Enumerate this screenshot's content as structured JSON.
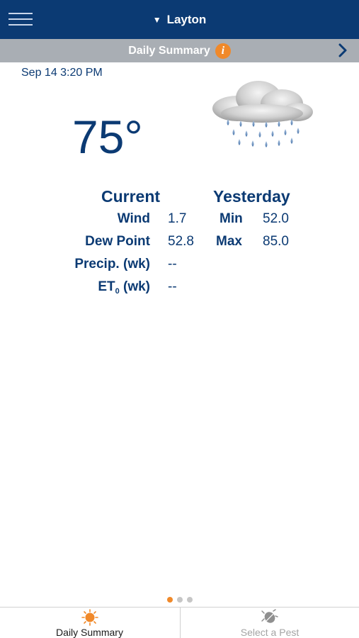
{
  "header": {
    "location": "Layton",
    "subtitle": "Daily Summary"
  },
  "summary": {
    "timestamp": "Sep 14 3:20 PM",
    "temperature": "75°",
    "weather_icon": "rain-cloud-icon"
  },
  "current": {
    "heading": "Current",
    "wind_label": "Wind",
    "wind_value": "1.7",
    "dew_label": "Dew Point",
    "dew_value": "52.8",
    "precip_label": "Precip. (wk)",
    "precip_value": "--",
    "et_label_main": "ET",
    "et_label_sub": "0",
    "et_label_tail": " (wk)",
    "et_value": "--"
  },
  "yesterday": {
    "heading": "Yesterday",
    "min_label": "Min",
    "min_value": "52.0",
    "max_label": "Max",
    "max_value": "85.0"
  },
  "pager": {
    "pages": 3,
    "active": 0
  },
  "tabs": {
    "daily_summary": "Daily Summary",
    "select_pest": "Select a Pest"
  },
  "colors": {
    "navy": "#0b3a73",
    "accent_orange": "#f0892a",
    "subbar_gray": "#a9aeb4"
  }
}
